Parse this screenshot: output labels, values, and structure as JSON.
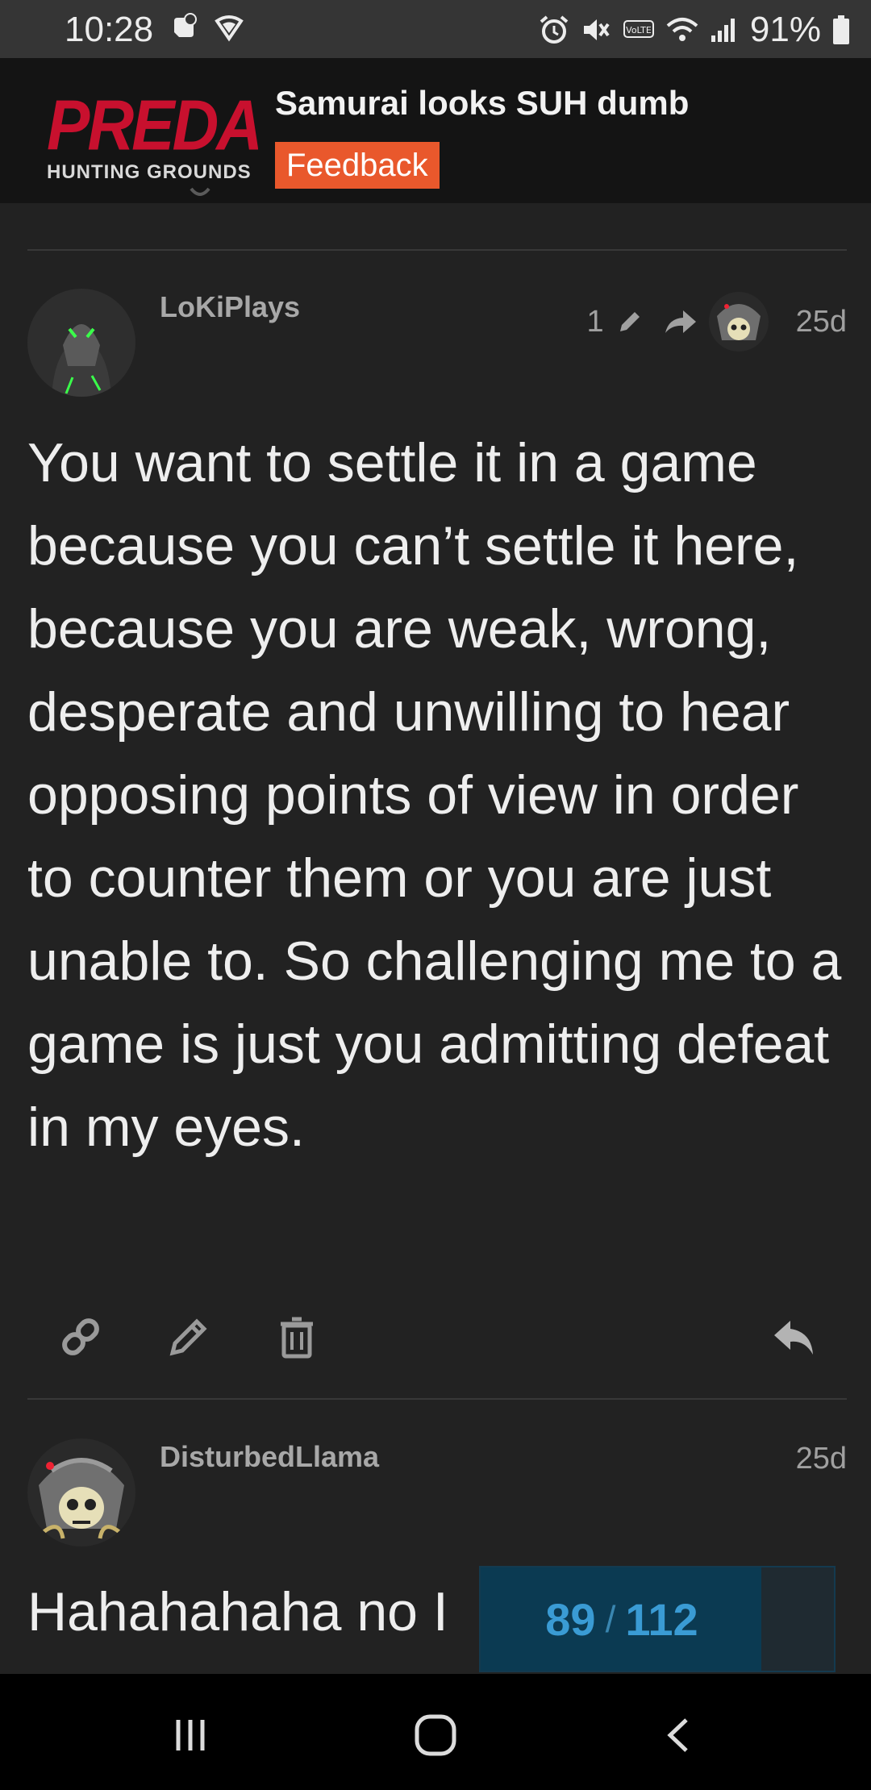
{
  "status_bar": {
    "time": "10:28",
    "battery": "91%",
    "left_icons": [
      "game-launcher-icon",
      "shield-icon"
    ],
    "right_icons": [
      "alarm-icon",
      "mute-icon",
      "volte-icon",
      "wifi-icon",
      "signal-icon",
      "battery-icon"
    ]
  },
  "header": {
    "logo_text": "PREDATOR",
    "logo_subtext": "HUNTING GROUNDS",
    "topic_title": "Samurai looks SUH dumb",
    "category": "Feedback",
    "category_color": "#e9582c"
  },
  "posts": [
    {
      "username": "LoKiPlays",
      "edit_count": "1",
      "age": "25d",
      "body": "You want to settle it in a game because you can’t settle it here, because you are weak, wrong, desperate and unwilling to hear opposing points of view in order to counter them or you are just unable to. So challenging me to a game is just you admitting defeat in my eyes."
    },
    {
      "username": "DisturbedLlama",
      "age": "25d",
      "body": "Hahahahaha no I"
    }
  ],
  "timeline": {
    "current": "89",
    "separator": "/",
    "total": "112",
    "progress_fraction": 0.795
  },
  "nav_bar": {
    "buttons": [
      "recent-apps-icon",
      "home-icon",
      "back-icon"
    ]
  }
}
